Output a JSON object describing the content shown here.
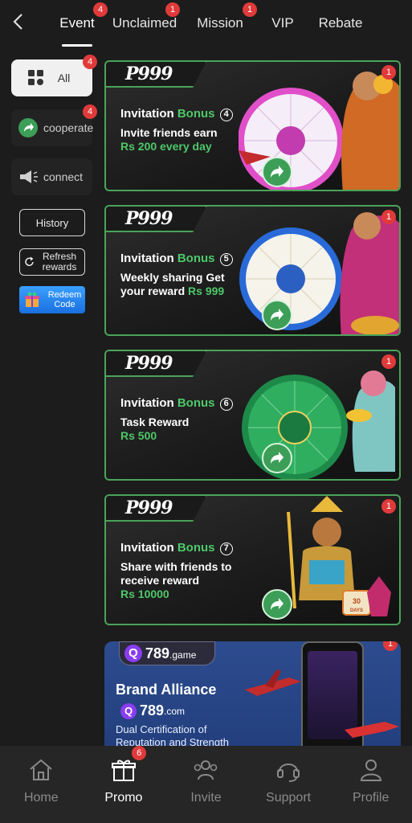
{
  "tabs": [
    {
      "label": "Event",
      "badge": "4"
    },
    {
      "label": "Unclaimed",
      "badge": "1"
    },
    {
      "label": "Mission",
      "badge": "1"
    },
    {
      "label": "VIP",
      "badge": ""
    },
    {
      "label": "Rebate",
      "badge": ""
    }
  ],
  "sidebar": {
    "all": {
      "label": "All",
      "badge": "4"
    },
    "cooperate": {
      "label": "cooperate",
      "badge": "4"
    },
    "connect": {
      "label": "connect"
    },
    "history": "History",
    "refresh": "Refresh rewards",
    "redeem": "Redeem Code"
  },
  "cards": [
    {
      "brand": "P999",
      "title_a": "Invitation",
      "title_b": "Bonus",
      "num": "4",
      "sub": "Invite friends earn",
      "amount": "Rs 200 every day",
      "badge": "1"
    },
    {
      "brand": "P999",
      "title_a": "Invitation",
      "title_b": "Bonus",
      "num": "5",
      "sub1": "Weekly sharing Get",
      "sub2": "your reward",
      "amount": "Rs 999",
      "badge": "1"
    },
    {
      "brand": "P999",
      "title_a": "Invitation",
      "title_b": "Bonus",
      "num": "6",
      "sub": "Task Reward",
      "amount": "Rs 500",
      "badge": "1"
    },
    {
      "brand": "P999",
      "title_a": "Invitation",
      "title_b": "Bonus",
      "num": "7",
      "sub": "Share with friends to receive reward",
      "amount": "Rs 10000",
      "badge": "1"
    }
  ],
  "brand_card": {
    "pill": "789",
    "pill_suffix": ".game",
    "heading": "Brand Alliance",
    "domain": "789",
    "domain_suffix": ".com",
    "desc": "Dual Certification of Reputation and Strength",
    "badge": "1"
  },
  "bottom_nav": [
    {
      "label": "Home",
      "icon": "home-icon",
      "badge": ""
    },
    {
      "label": "Promo",
      "icon": "gift-icon",
      "badge": "6"
    },
    {
      "label": "Invite",
      "icon": "invite-icon",
      "badge": ""
    },
    {
      "label": "Support",
      "icon": "headset-icon",
      "badge": ""
    },
    {
      "label": "Profile",
      "icon": "profile-icon",
      "badge": ""
    }
  ],
  "colors": {
    "accent_green": "#4ec86a",
    "badge_red": "#e03a3a",
    "background": "#1c1c1c"
  }
}
